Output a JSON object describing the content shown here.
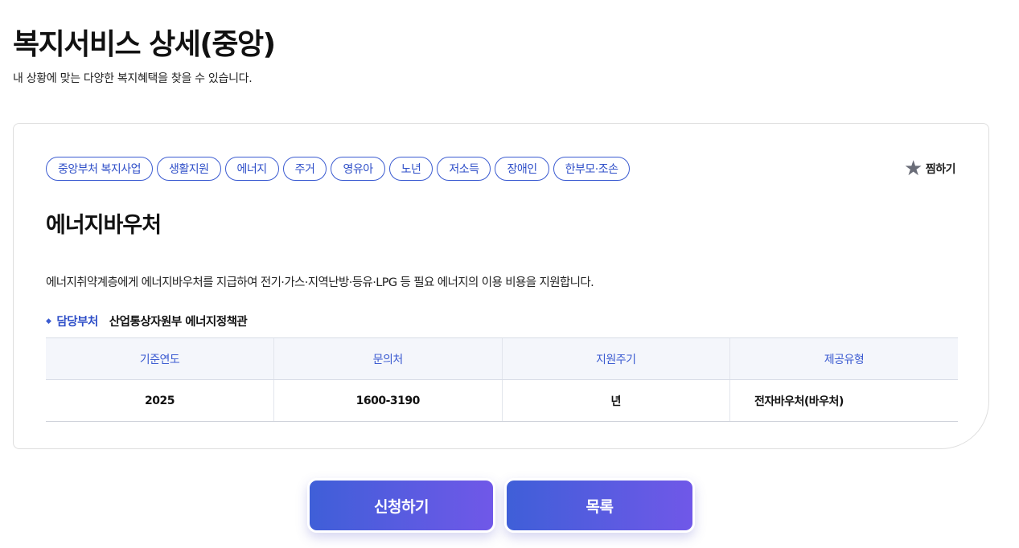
{
  "header": {
    "title": "복지서비스 상세(중앙)",
    "subtitle": "내 상황에 맞는 다양한 복지혜택을 찾을 수 있습니다."
  },
  "tags": [
    "중앙부처 복지사업",
    "생활지원",
    "에너지",
    "주거",
    "영유아",
    "노년",
    "저소득",
    "장애인",
    "한부모·조손"
  ],
  "favorite": {
    "icon": "star-icon",
    "label": "찜하기"
  },
  "service": {
    "title": "에너지바우처",
    "description": "에너지취약계층에게 에너지바우처를 지급하여 전기·가스·지역난방·등유·LPG 등 필요 에너지의 이용 비용을 지원합니다.",
    "dept_label": "담당부처",
    "dept_value": "산업통상자원부 에너지정책관"
  },
  "table": {
    "headers": [
      "기준연도",
      "문의처",
      "지원주기",
      "제공유형"
    ],
    "row": [
      "2025",
      "1600-3190",
      "년",
      "전자바우처(바우처)"
    ]
  },
  "buttons": {
    "apply": "신청하기",
    "list": "목록"
  },
  "colors": {
    "accent": "#3b5bd1",
    "gradient_start": "#3f5fd8",
    "gradient_end": "#7058e8"
  }
}
